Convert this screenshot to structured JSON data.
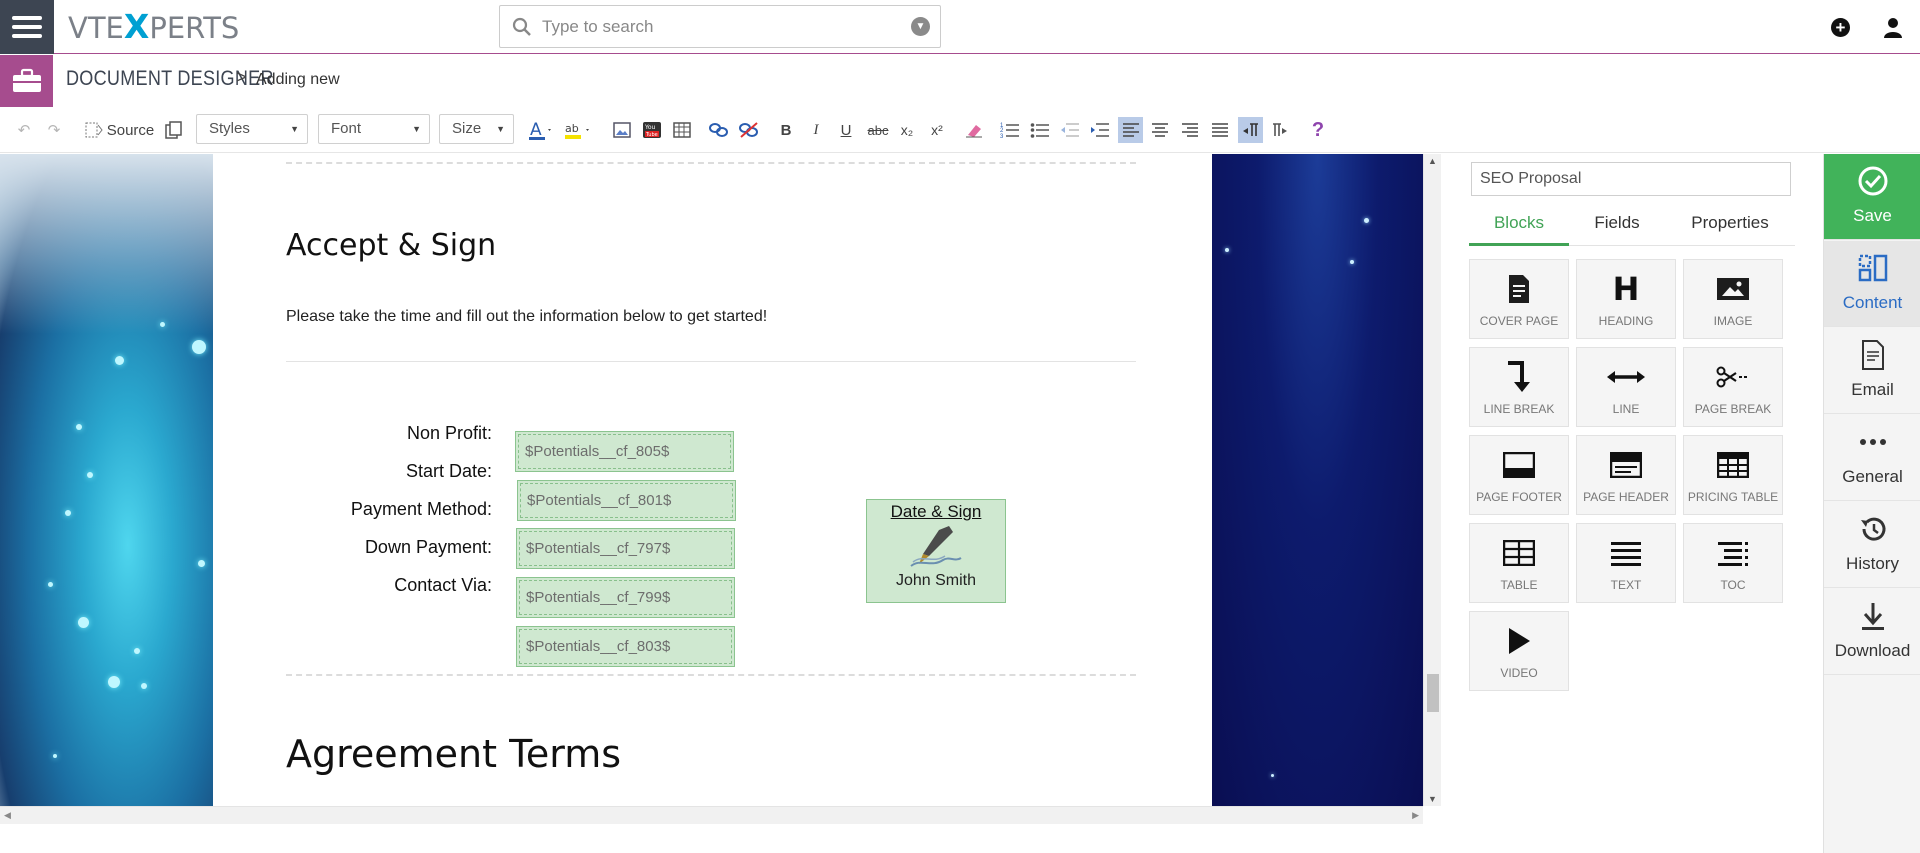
{
  "header": {
    "logo_left": "VTE",
    "logo_x": "X",
    "logo_right": "PERTS",
    "search_placeholder": "Type to search"
  },
  "breadcrumb": {
    "module": "DOCUMENT DESIGNER",
    "separator": ">",
    "current": "Adding new"
  },
  "toolbar": {
    "source_label": "Source",
    "styles_label": "Styles",
    "font_label": "Font",
    "size_label": "Size",
    "bold": "B",
    "italic": "I",
    "underline": "U",
    "strike": "abc",
    "subscript": "x₂",
    "superscript": "x²",
    "help": "?"
  },
  "document": {
    "heading_accept": "Accept & Sign",
    "intro": "Please take the time and fill out the information below to get started!",
    "field_labels": [
      "Non Profit:",
      "Start Date:",
      "Payment Method:",
      "Down Payment:",
      "Contact Via:"
    ],
    "field_values": [
      "$Potentials__cf_805$",
      "$Potentials__cf_801$",
      "$Potentials__cf_797$",
      "$Potentials__cf_799$",
      "$Potentials__cf_803$"
    ],
    "sign_title": "Date & Sign",
    "sign_name": "John Smith",
    "heading_agreement": "Agreement Terms"
  },
  "panel": {
    "template_name": "SEO Proposal",
    "tabs": [
      "Blocks",
      "Fields",
      "Properties"
    ],
    "active_tab": "Blocks",
    "blocks": [
      "COVER PAGE",
      "HEADING",
      "IMAGE",
      "LINE BREAK",
      "LINE",
      "PAGE BREAK",
      "PAGE FOOTER",
      "PAGE HEADER",
      "PRICING TABLE",
      "TABLE",
      "TEXT",
      "TOC",
      "VIDEO"
    ],
    "block_icons": [
      "document-icon",
      "heading-icon",
      "image-icon",
      "line-break-icon",
      "line-icon",
      "scissors-icon",
      "page-footer-icon",
      "page-header-icon",
      "pricing-table-icon",
      "table-icon",
      "text-icon",
      "toc-icon",
      "play-icon"
    ]
  },
  "menu": {
    "items": [
      "Save",
      "Content",
      "Email",
      "General",
      "History",
      "Download"
    ]
  },
  "colors": {
    "brand_purple": "#a64c8e",
    "save_green": "#41b35a",
    "tab_green": "#41a356",
    "active_blue": "#2b6cc4",
    "field_green": "#cfe8d0"
  }
}
